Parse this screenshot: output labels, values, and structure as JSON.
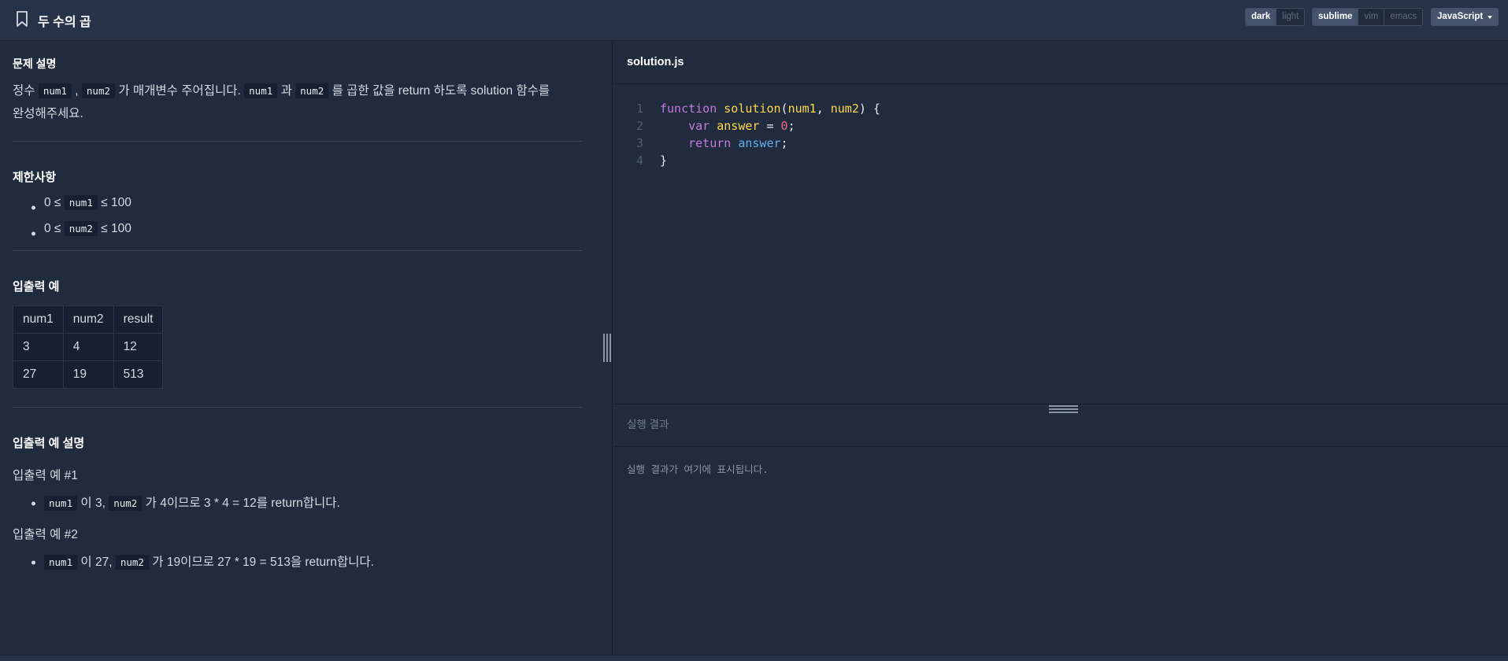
{
  "header": {
    "title": "두 수의 곱",
    "theme_options": [
      {
        "label": "dark",
        "active": true
      },
      {
        "label": "light",
        "active": false
      }
    ],
    "keymap_options": [
      {
        "label": "sublime",
        "active": true
      },
      {
        "label": "vim",
        "active": false
      },
      {
        "label": "emacs",
        "active": false
      }
    ],
    "language": "JavaScript"
  },
  "problem": {
    "section_title": "문제 설명",
    "description": {
      "p1": "정수",
      "c1": "num1",
      "p2": ",",
      "c2": "num2",
      "p3": "가 매개변수 주어집니다.",
      "c3": "num1",
      "p4": "과",
      "c4": "num2",
      "p5": "를 곱한 값을 return 하도록 solution 함수를",
      "p6": "완성해주세요."
    },
    "constraints": {
      "title": "제한사항",
      "items": [
        {
          "pre": "0 ≤",
          "code": "num1",
          "post": "≤ 100"
        },
        {
          "pre": "0 ≤",
          "code": "num2",
          "post": "≤ 100"
        }
      ]
    },
    "examples": {
      "title": "입출력 예",
      "headers": [
        "num1",
        "num2",
        "result"
      ],
      "rows": [
        [
          "3",
          "4",
          "12"
        ],
        [
          "27",
          "19",
          "513"
        ]
      ]
    },
    "explanation": {
      "title": "입출력 예 설명",
      "cases": [
        {
          "label": "입출력 예 #1",
          "code1": "num1",
          "t1": "이 3,",
          "code2": "num2",
          "t2": "가 4이므로 3 * 4 = 12를 return합니다."
        },
        {
          "label": "입출력 예 #2",
          "code1": "num1",
          "t1": "이 27,",
          "code2": "num2",
          "t2": "가 19이므로 27 * 19 = 513을 return합니다."
        }
      ]
    }
  },
  "editor": {
    "filename": "solution.js",
    "lines": [
      {
        "n": "1",
        "kw": "function",
        "fn": "solution",
        "p1": "num1",
        "sep": ", ",
        "p2": "num2",
        "tail": ") {"
      },
      {
        "n": "2",
        "indent": "    ",
        "kw": "var",
        "vname": "answer",
        "op": " = ",
        "num": "0",
        "end": ";"
      },
      {
        "n": "3",
        "indent": "    ",
        "kw": "return",
        "vname": "answer",
        "end": ";"
      },
      {
        "n": "4",
        "text": "}"
      }
    ]
  },
  "results": {
    "title": "실행 결과",
    "placeholder": "실행 결과가 여기에 표시됩니다."
  }
}
